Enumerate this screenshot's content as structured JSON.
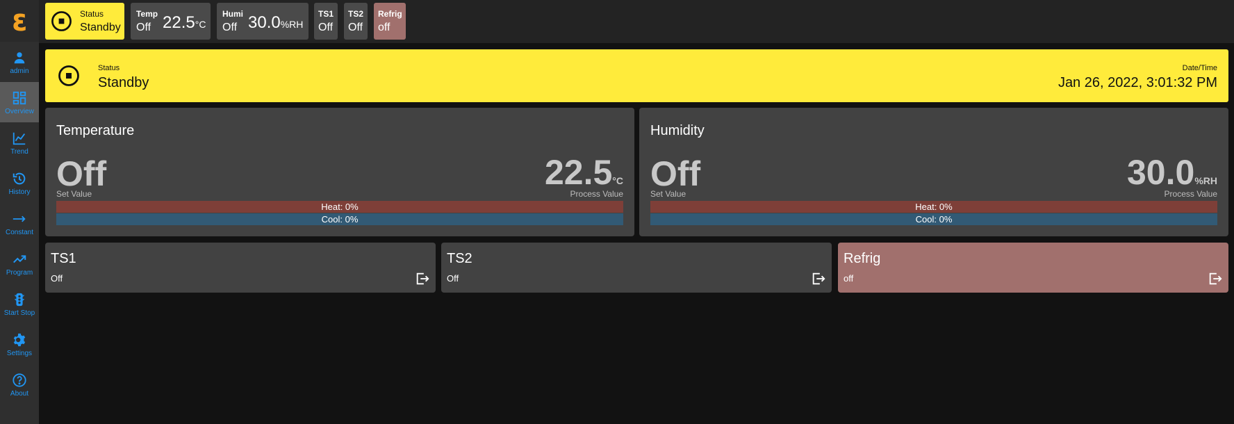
{
  "app": {
    "logo_glyph": "ε",
    "accent": "#2196f3",
    "status_color": "#ffeb3b",
    "alert_color": "#a1706d"
  },
  "sidebar": {
    "items": [
      {
        "label": "admin",
        "icon": "user-icon"
      },
      {
        "label": "Overview",
        "icon": "dashboard-icon",
        "active": true
      },
      {
        "label": "Trend",
        "icon": "chart-line-icon"
      },
      {
        "label": "History",
        "icon": "history-icon"
      },
      {
        "label": "Constant",
        "icon": "arrow-right-icon"
      },
      {
        "label": "Program",
        "icon": "trending-up-icon"
      },
      {
        "label": "Start Stop",
        "icon": "traffic-light-icon"
      },
      {
        "label": "Settings",
        "icon": "gear-icon"
      },
      {
        "label": "About",
        "icon": "help-circle-icon"
      }
    ]
  },
  "topbar": {
    "status": {
      "label": "Status",
      "value": "Standby",
      "icon": "stop-circle-icon"
    },
    "temp": {
      "label": "Temp",
      "state": "Off",
      "value": "22.5",
      "unit": "°C"
    },
    "humi": {
      "label": "Humi",
      "state": "Off",
      "value": "30.0",
      "unit": "%RH"
    },
    "ts1": {
      "label": "TS1",
      "value": "Off"
    },
    "ts2": {
      "label": "TS2",
      "value": "Off"
    },
    "refrig": {
      "label": "Refrig",
      "value": "off"
    }
  },
  "banner": {
    "status_label": "Status",
    "status_value": "Standby",
    "datetime_label": "Date/Time",
    "datetime_value": "Jan 26, 2022, 3:01:32 PM"
  },
  "temperature": {
    "title": "Temperature",
    "set_value": "Off",
    "set_label": "Set Value",
    "process_value": "22.5",
    "unit": "°C",
    "process_label": "Process Value",
    "heat": "Heat: 0%",
    "cool": "Cool: 0%"
  },
  "humidity": {
    "title": "Humidity",
    "set_value": "Off",
    "set_label": "Set Value",
    "process_value": "30.0",
    "unit": "%RH",
    "process_label": "Process Value",
    "heat": "Heat: 0%",
    "cool": "Cool: 0%"
  },
  "tiles": [
    {
      "title": "TS1",
      "state": "Off",
      "icon": "exit-icon"
    },
    {
      "title": "TS2",
      "state": "Off",
      "icon": "exit-icon"
    },
    {
      "title": "Refrig",
      "state": "off",
      "icon": "exit-icon"
    }
  ]
}
